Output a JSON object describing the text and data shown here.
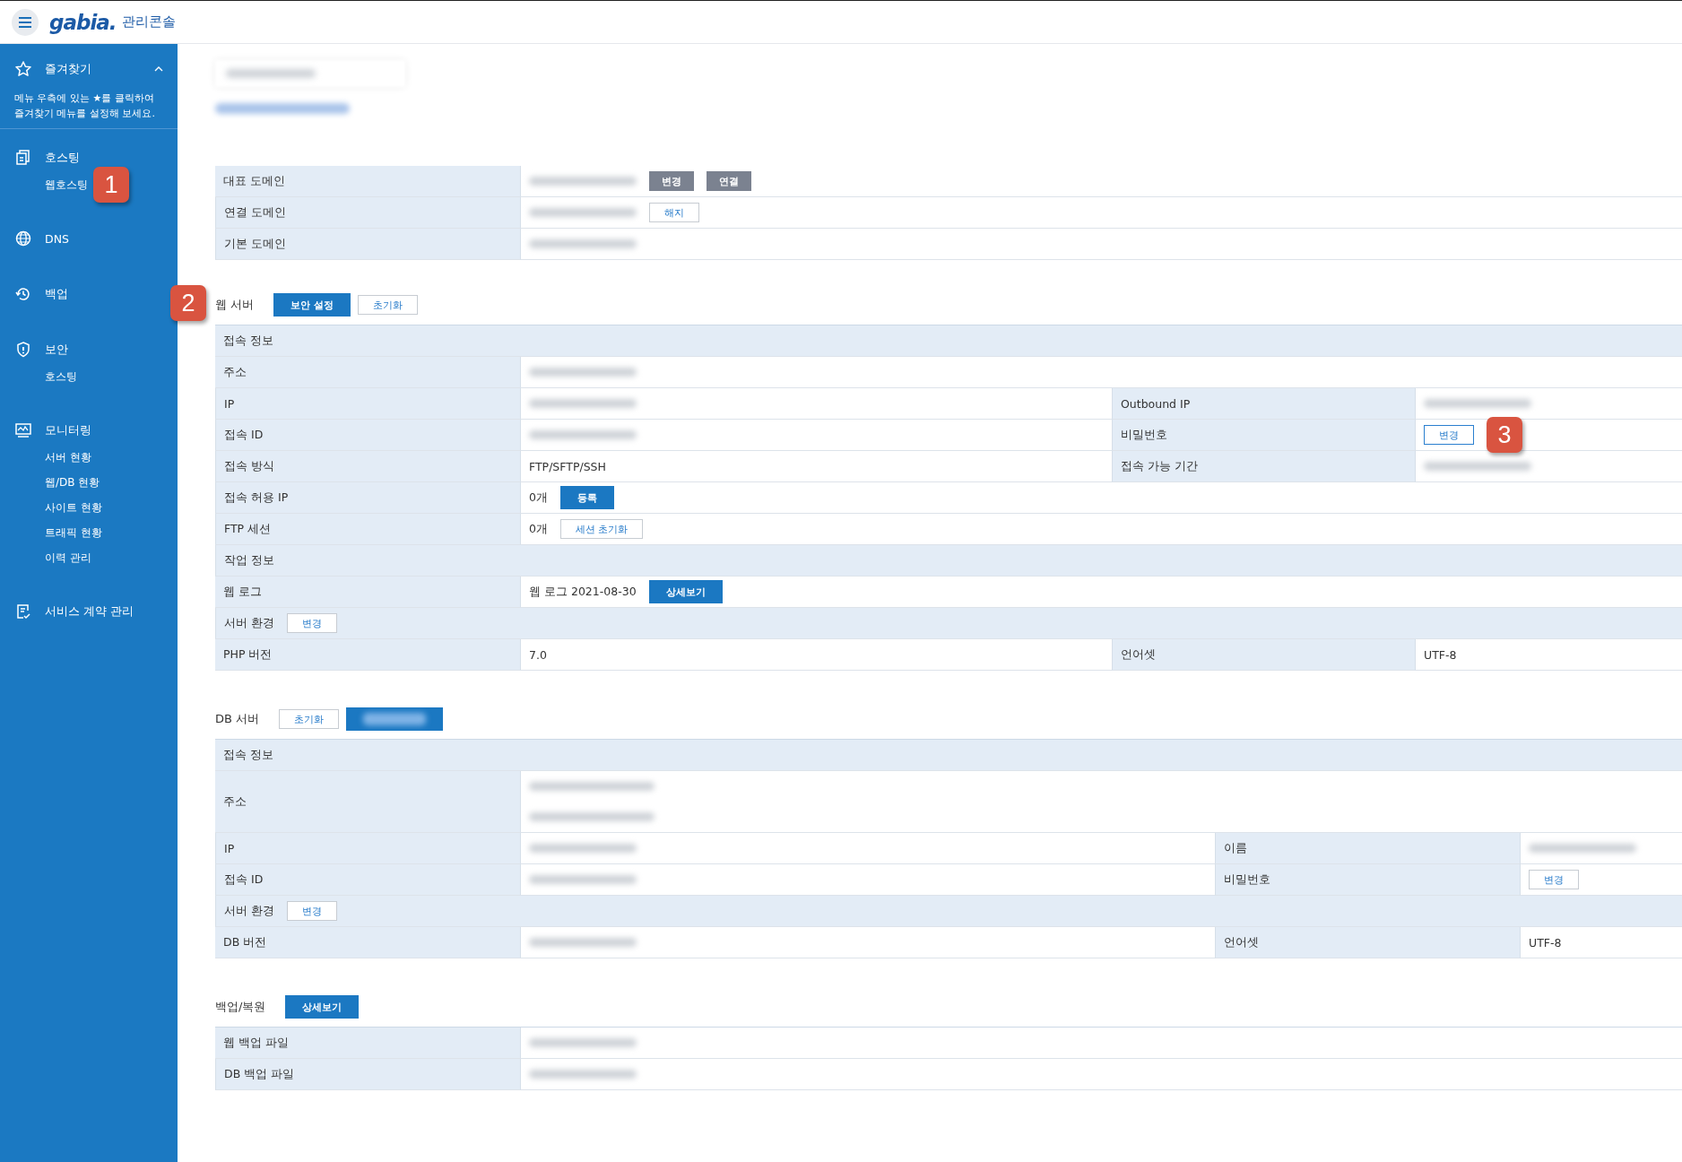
{
  "header": {
    "logo": "gabia.",
    "title": "관리콘솔"
  },
  "sidebar": {
    "favorites": {
      "label": "즐겨찾기",
      "expanded": true,
      "hint": "메뉴 우측에 있는 ★를 클릭하여 즐겨찾기 메뉴를 설정해 보세요."
    },
    "groups": [
      {
        "kind": "hosting",
        "label": "호스팅",
        "children": [
          {
            "label": "웹호스팅",
            "badge": "1"
          }
        ]
      },
      {
        "kind": "globe",
        "label": "DNS"
      },
      {
        "kind": "history",
        "label": "백업"
      },
      {
        "kind": "shield",
        "label": "보안",
        "children": [
          {
            "label": "호스팅"
          }
        ]
      },
      {
        "kind": "monitor",
        "label": "모니터링",
        "children": [
          {
            "label": "서버 현황"
          },
          {
            "label": "웹/DB 현황"
          },
          {
            "label": "사이트 현황"
          },
          {
            "label": "트래픽 현황"
          },
          {
            "label": "이력 관리"
          }
        ]
      },
      {
        "kind": "contract",
        "label": "서비스 계약 관리"
      }
    ]
  },
  "sections": [
    {
      "kind": "domains",
      "rows": [
        {
          "kind": "pair",
          "label": "대표 도메인",
          "values": [
            {
              "kind": "blurred"
            },
            {
              "kind": "grey",
              "label": "변경"
            },
            {
              "kind": "grey",
              "label": "연결"
            }
          ]
        },
        {
          "kind": "pair",
          "label": "연결 도메인",
          "values": [
            {
              "kind": "blurred"
            },
            {
              "kind": "outline",
              "label": "해지"
            }
          ]
        },
        {
          "kind": "pair",
          "label": "기본 도메인",
          "values": [
            {
              "kind": "blurred"
            }
          ]
        }
      ]
    },
    {
      "kind": "web",
      "title": "웹 서버",
      "badge": "2",
      "buttons": [
        {
          "kind": "primary",
          "label": "보안 설정"
        },
        {
          "kind": "outline",
          "label": "초기화"
        }
      ],
      "rows": [
        {
          "kind": "header",
          "label": "접속 정보"
        },
        {
          "kind": "pair",
          "label": "주소",
          "values": [
            {
              "kind": "blurred"
            }
          ]
        },
        {
          "kind": "quad",
          "label": "IP",
          "values": [
            {
              "kind": "blurred"
            }
          ],
          "label2": "Outbound IP",
          "values2": [
            {
              "kind": "blurred"
            }
          ]
        },
        {
          "kind": "quad",
          "label": "접속 ID",
          "values": [
            {
              "kind": "blurred"
            }
          ],
          "label2": "비밀번호",
          "values2": [
            {
              "kind": "outline-strong",
              "label": "변경",
              "badge": "3"
            }
          ]
        },
        {
          "kind": "quad",
          "label": "접속 방식",
          "values": [
            {
              "kind": "text",
              "text": "FTP/SFTP/SSH"
            }
          ],
          "label2": "접속 가능 기간",
          "values2": [
            {
              "kind": "blurred"
            }
          ]
        },
        {
          "kind": "pair",
          "label": "접속 허용 IP",
          "values": [
            {
              "kind": "text",
              "text": "0개"
            },
            {
              "kind": "primary",
              "label": "등록"
            }
          ]
        },
        {
          "kind": "pair",
          "label": "FTP 세션",
          "values": [
            {
              "kind": "text",
              "text": "0개"
            },
            {
              "kind": "outline",
              "label": "세션 초기화"
            }
          ]
        },
        {
          "kind": "header",
          "label": "작업 정보"
        },
        {
          "kind": "pair",
          "label": "웹 로그",
          "values": [
            {
              "kind": "text",
              "text": "웹 로그 2021-08-30"
            },
            {
              "kind": "primary",
              "label": "상세보기"
            }
          ]
        },
        {
          "kind": "header",
          "label": "서버 환경",
          "button": {
            "kind": "outline",
            "label": "변경"
          }
        },
        {
          "kind": "quad",
          "label": "PHP 버전",
          "values": [
            {
              "kind": "text",
              "text": "7.0"
            }
          ],
          "label2": "언어셋",
          "values2": [
            {
              "kind": "text",
              "text": "UTF-8"
            }
          ]
        }
      ]
    },
    {
      "kind": "db",
      "title": "DB 서버",
      "buttons": [
        {
          "kind": "outline",
          "label": "초기화"
        },
        {
          "kind": "primary-blurred"
        }
      ],
      "rows": [
        {
          "kind": "header",
          "label": "접속 정보"
        },
        {
          "kind": "stacked",
          "label": "주소",
          "values": [
            {
              "kind": "blurred"
            },
            {
              "kind": "blurred"
            }
          ]
        },
        {
          "kind": "quad",
          "label": "IP",
          "values": [
            {
              "kind": "blurred"
            }
          ],
          "label2": "이름",
          "values2": [
            {
              "kind": "blurred"
            }
          ]
        },
        {
          "kind": "quad",
          "label": "접속 ID",
          "values": [
            {
              "kind": "blurred"
            }
          ],
          "label2": "비밀번호",
          "values2": [
            {
              "kind": "outline",
              "label": "변경"
            }
          ]
        },
        {
          "kind": "header",
          "label": "서버 환경",
          "button": {
            "kind": "outline",
            "label": "변경"
          }
        },
        {
          "kind": "quad",
          "label": "DB 버전",
          "values": [
            {
              "kind": "blurred"
            }
          ],
          "label2": "언어셋",
          "values2": [
            {
              "kind": "text",
              "text": "UTF-8"
            }
          ]
        }
      ]
    },
    {
      "kind": "backup",
      "title": "백업/복원",
      "buttons": [
        {
          "kind": "primary",
          "label": "상세보기"
        }
      ],
      "rows": [
        {
          "kind": "pair",
          "label": "웹 백업 파일",
          "values": [
            {
              "kind": "blurred"
            }
          ]
        },
        {
          "kind": "pair",
          "label": "DB 백업 파일",
          "values": [
            {
              "kind": "blurred"
            }
          ]
        }
      ]
    }
  ]
}
